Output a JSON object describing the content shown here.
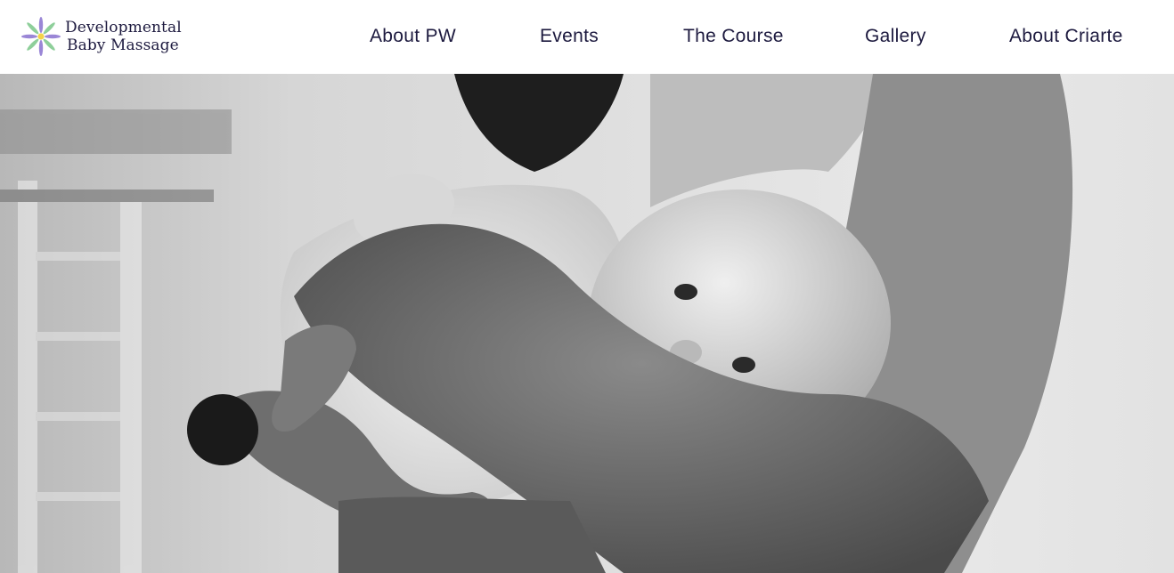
{
  "header": {
    "logo": {
      "line1": "Developmental",
      "line2": "Baby Massage",
      "icon": "flower-logo-icon",
      "colors": {
        "petal_purple": "#9a86d6",
        "petal_green": "#8ecf9a",
        "center_yellow": "#f3d34a"
      }
    },
    "nav": [
      {
        "label": "About PW"
      },
      {
        "label": "Events"
      },
      {
        "label": "The Course"
      },
      {
        "label": "Gallery"
      },
      {
        "label": "About Criarte"
      }
    ]
  },
  "hero": {
    "image": "black-and-white photo of a newborn baby held against a parent's shoulder"
  },
  "colors": {
    "text": "#1d1a3f",
    "header_bg": "#ffffff"
  }
}
